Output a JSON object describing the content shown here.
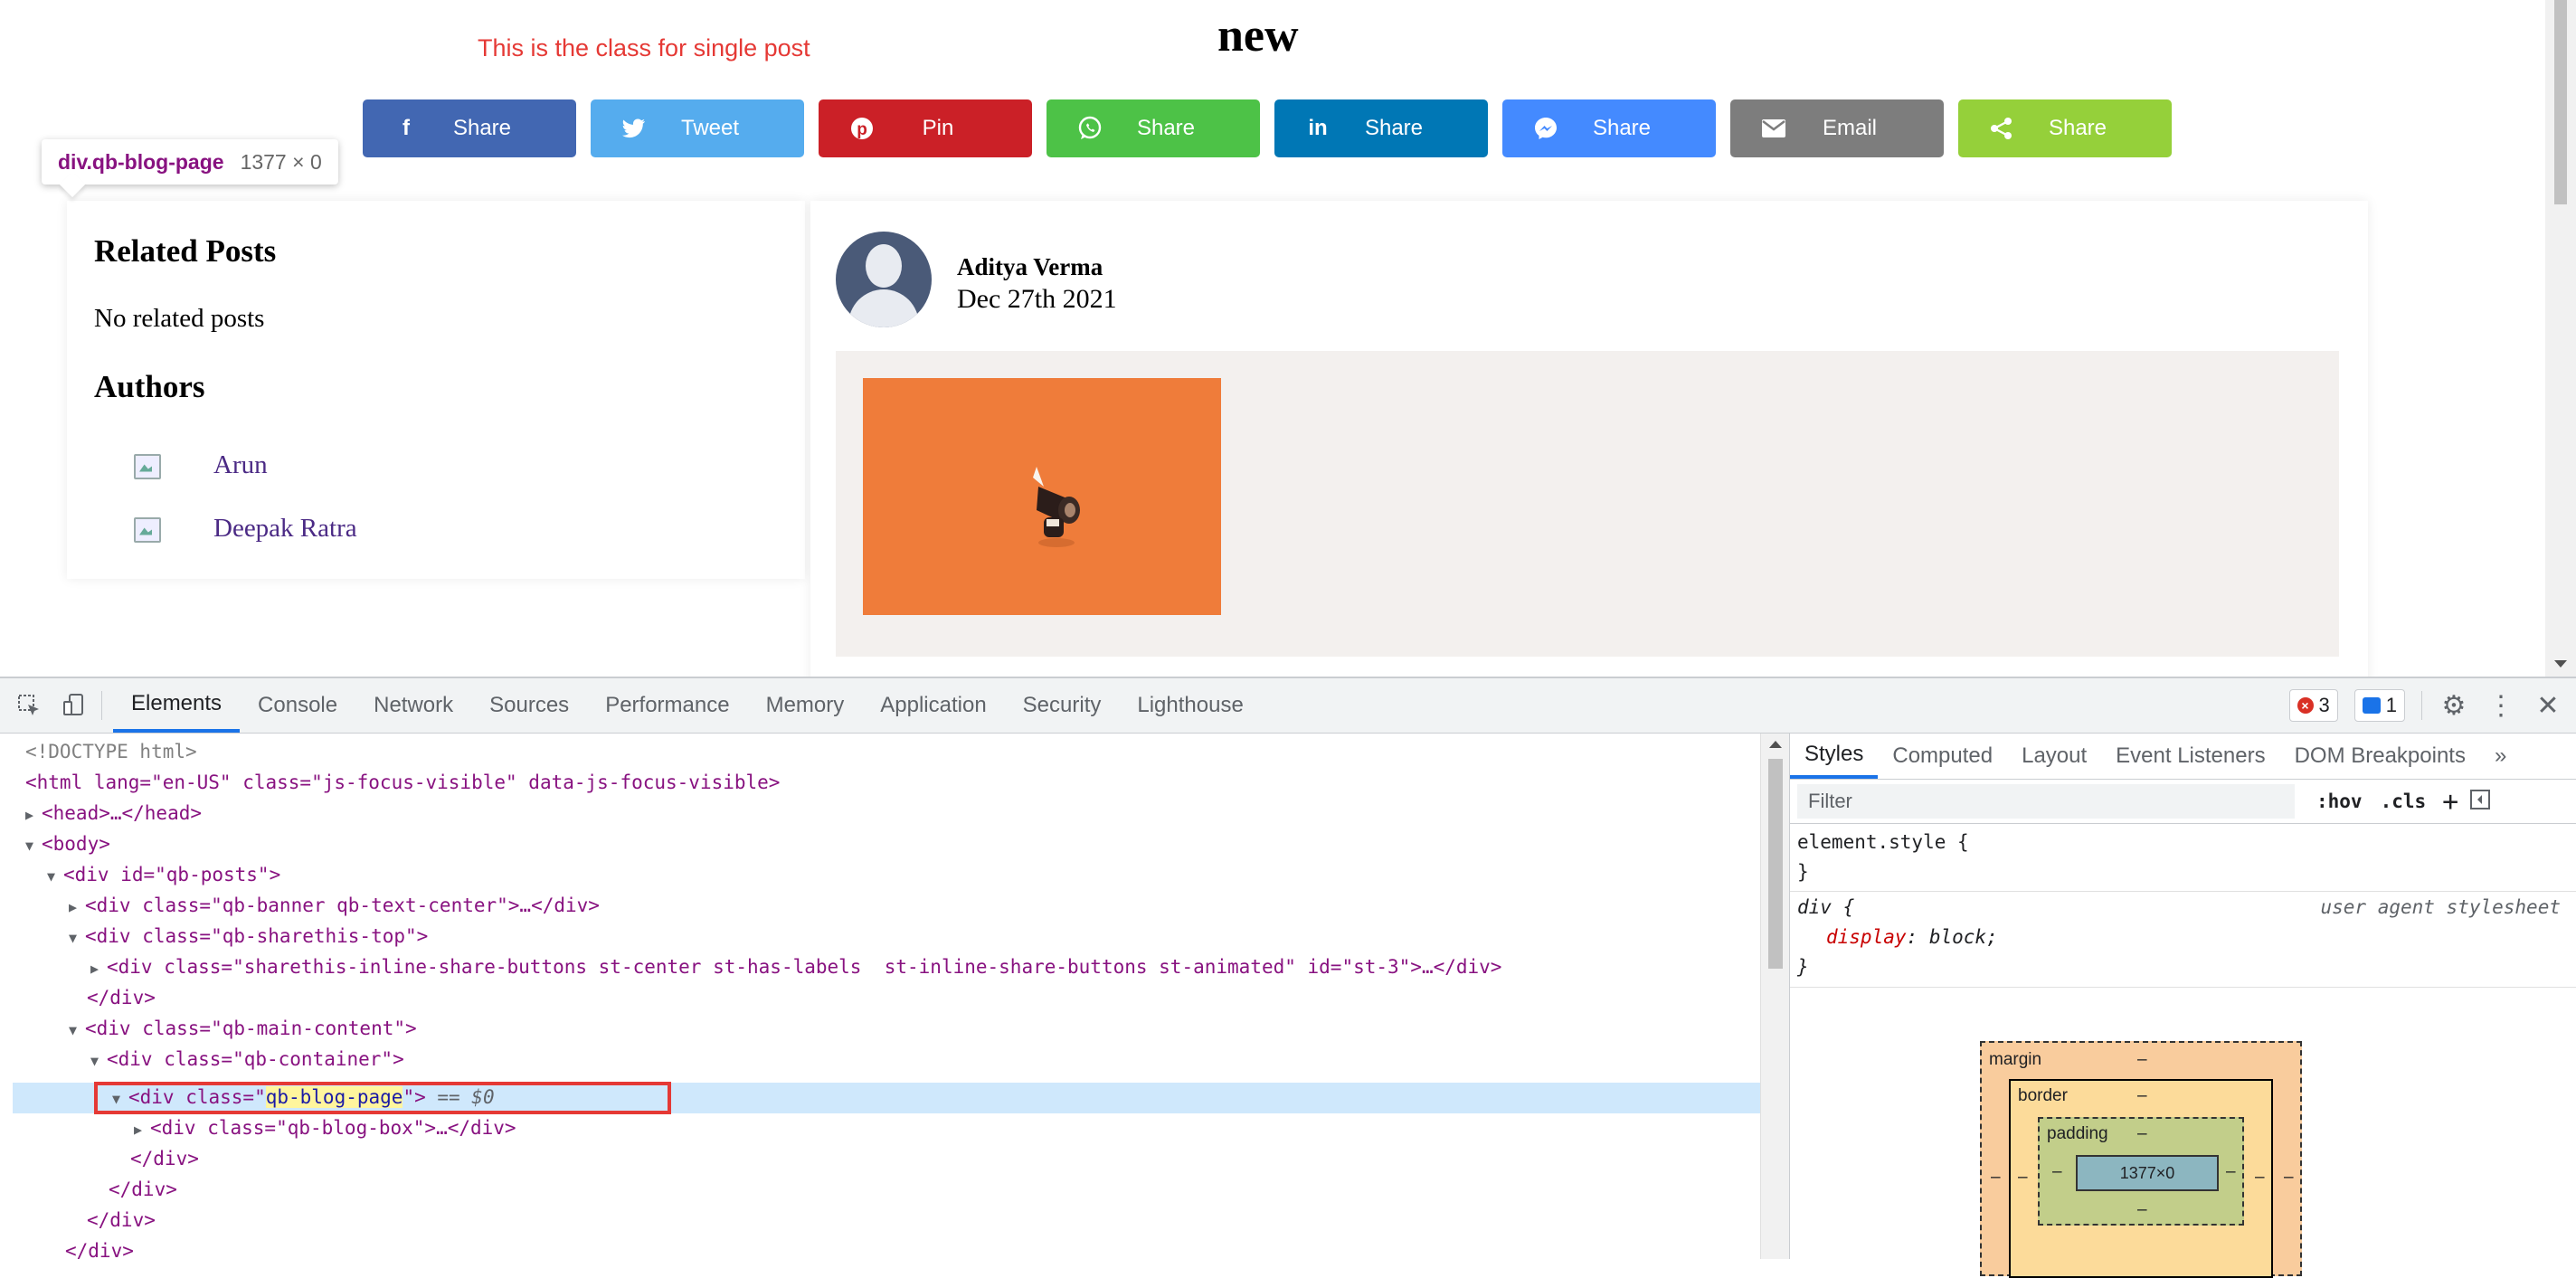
{
  "page": {
    "subtitle": "This is the class for single post",
    "title": "new"
  },
  "share_buttons": [
    {
      "label": "Share",
      "icon": "facebook-icon",
      "color": "#4267b2"
    },
    {
      "label": "Tweet",
      "icon": "twitter-icon",
      "color": "#55acee"
    },
    {
      "label": "Pin",
      "icon": "pinterest-icon",
      "color": "#cb2027"
    },
    {
      "label": "Share",
      "icon": "whatsapp-icon",
      "color": "#4dc247"
    },
    {
      "label": "Share",
      "icon": "linkedin-icon",
      "color": "#0077b5"
    },
    {
      "label": "Share",
      "icon": "messenger-icon",
      "color": "#448aff"
    },
    {
      "label": "Email",
      "icon": "email-icon",
      "color": "#7d7d7d"
    },
    {
      "label": "Share",
      "icon": "share-icon",
      "color": "#95d03a"
    }
  ],
  "tooltip": {
    "selector": "div.qb-blog-page",
    "size": "1377 × 0"
  },
  "sidebar": {
    "related_title": "Related Posts",
    "related_empty": "No related posts",
    "authors_title": "Authors",
    "authors": [
      "Arun",
      "Deepak Ratra"
    ]
  },
  "post": {
    "author": "Aditya Verma",
    "date": "Dec 27th 2021"
  },
  "devtools": {
    "tabs": [
      "Elements",
      "Console",
      "Network",
      "Sources",
      "Performance",
      "Memory",
      "Application",
      "Security",
      "Lighthouse"
    ],
    "active_tab": "Elements",
    "error_count": "3",
    "message_count": "1",
    "styles_tabs": [
      "Styles",
      "Computed",
      "Layout",
      "Event Listeners",
      "DOM Breakpoints"
    ],
    "filter_placeholder": "Filter",
    "hov": ":hov",
    "cls": ".cls",
    "element_style": "element.style {",
    "close_brace": "}",
    "rule_selector": "div {",
    "rule_source": "user agent stylesheet",
    "rule_prop": "display",
    "rule_val": "block;",
    "box_model": {
      "margin": "margin",
      "border": "border",
      "padding": "padding",
      "content": "1377×0",
      "dash": "–"
    },
    "dom": {
      "doctype": "<!DOCTYPE html>",
      "html_open": "<html lang=\"en-US\" class=\"js-focus-visible\" data-js-focus-visible>",
      "head": "<head>…</head>",
      "body": "<body>",
      "posts": "<div id=\"qb-posts\">",
      "banner": "<div class=\"qb-banner qb-text-center\">…</div>",
      "sharethis_top": "<div class=\"qb-sharethis-top\">",
      "inline_share": "<div class=\"sharethis-inline-share-buttons st-center st-has-labels  st-inline-share-buttons st-animated\" id=\"st-3\">…</div>",
      "close_div": "</div>",
      "main_content": "<div class=\"qb-main-content\">",
      "container": "<div class=\"qb-container\">",
      "blog_page_pre": "<div class=\"",
      "blog_page_class": "qb-blog-page",
      "blog_page_post": "\">",
      "blog_page_eq": " == $0",
      "blog_box": "<div class=\"qb-blog-box\">…</div>"
    }
  }
}
